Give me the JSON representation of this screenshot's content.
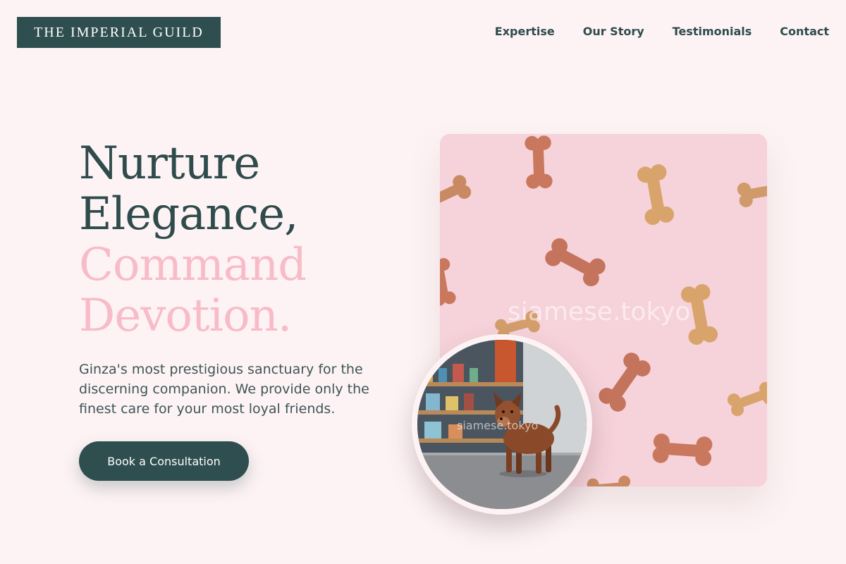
{
  "brand": {
    "logo_text": "THE IMPERIAL GUILD"
  },
  "nav": {
    "items": [
      {
        "label": "Expertise"
      },
      {
        "label": "Our Story"
      },
      {
        "label": "Testimonials"
      },
      {
        "label": "Contact"
      }
    ]
  },
  "hero": {
    "headline_lines": [
      "Nurture",
      "Elegance,",
      "Command",
      "Devotion."
    ],
    "lead": "Ginza's most prestigious sanctuary for the discerning companion. We provide only the finest care for your most loyal friends.",
    "cta_label": "Book a Consultation",
    "image_watermark": "siamese.tokyo",
    "circle_watermark": "siamese.tokyo"
  },
  "colors": {
    "primary": "#2f4e4f",
    "accent_pink": "#f8bcc8",
    "background": "#fdf3f4",
    "photo_pink": "#f6d2da"
  }
}
